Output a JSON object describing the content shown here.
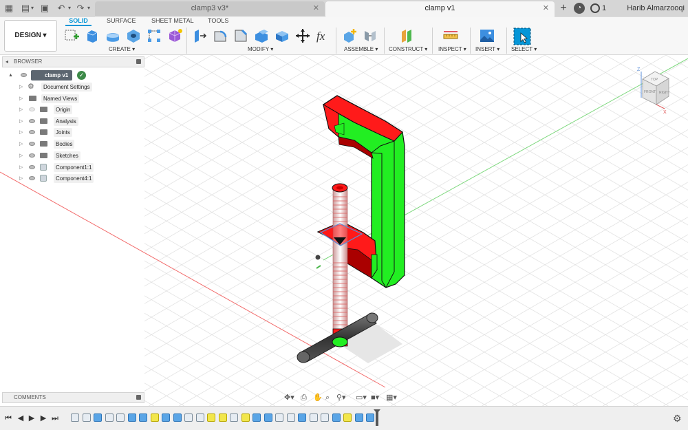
{
  "titlebar": {
    "tabs": [
      {
        "label": "clamp3 v3*"
      },
      {
        "label": "clamp v1"
      }
    ],
    "notifications": "1",
    "user": "Harib Almarzooqi"
  },
  "toolbar": {
    "workspace": "DESIGN",
    "workspace_tabs": [
      "SOLID",
      "SURFACE",
      "SHEET METAL",
      "TOOLS"
    ],
    "groups": [
      "CREATE",
      "MODIFY",
      "ASSEMBLE",
      "CONSTRUCT",
      "INSPECT",
      "INSERT",
      "SELECT"
    ]
  },
  "browser": {
    "title": "BROWSER",
    "root": "clamp v1",
    "items": [
      {
        "label": "Document Settings",
        "icon": "gear-icon"
      },
      {
        "label": "Named Views",
        "icon": "folder-icon"
      },
      {
        "label": "Origin",
        "icon": "folder-icon"
      },
      {
        "label": "Analysis",
        "icon": "folder-icon"
      },
      {
        "label": "Joints",
        "icon": "folder-icon"
      },
      {
        "label": "Bodies",
        "icon": "folder-icon"
      },
      {
        "label": "Sketches",
        "icon": "folder-icon"
      },
      {
        "label": "Component1:1",
        "icon": "component-icon"
      },
      {
        "label": "Component4:1",
        "icon": "component-icon"
      }
    ]
  },
  "comments": {
    "title": "COMMENTS"
  },
  "viewcube": {
    "top": "TOP",
    "front": "FRONT",
    "right": "RIGHT",
    "axis_z": "Z",
    "axis_x": "X"
  },
  "colors": {
    "accent": "#0696d7",
    "clamp_red": "#ff1a1a",
    "clamp_green": "#22ee22"
  }
}
